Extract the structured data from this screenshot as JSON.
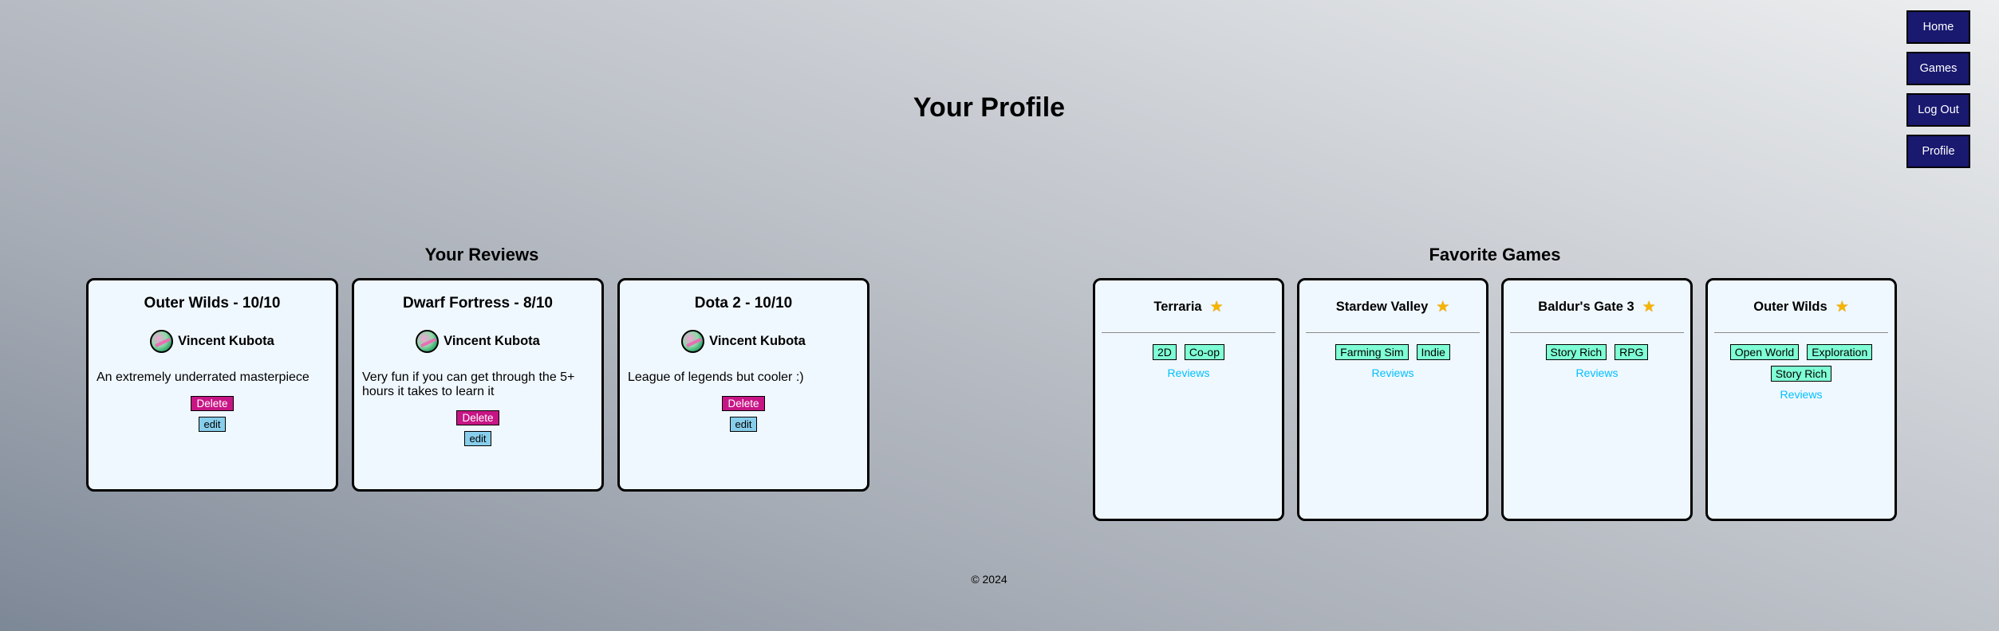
{
  "nav": {
    "items": [
      "Home",
      "Games",
      "Log Out",
      "Profile"
    ]
  },
  "page": {
    "title": "Your Profile"
  },
  "reviews_section": {
    "title": "Your Reviews",
    "cards": [
      {
        "title": "Outer Wilds - 10/10",
        "author": "Vincent Kubota",
        "text": "An extremely underrated masterpiece",
        "delete_label": "Delete",
        "edit_label": "edit"
      },
      {
        "title": "Dwarf Fortress - 8/10",
        "author": "Vincent Kubota",
        "text": "Very fun if you can get through the 5+ hours it takes to learn it",
        "delete_label": "Delete",
        "edit_label": "edit"
      },
      {
        "title": "Dota 2 - 10/10",
        "author": "Vincent Kubota",
        "text": "League of legends but cooler :)",
        "delete_label": "Delete",
        "edit_label": "edit"
      }
    ]
  },
  "favorites_section": {
    "title": "Favorite Games",
    "cards": [
      {
        "name": "Terraria",
        "icon": "star-icon",
        "tags": [
          "2D",
          "Co-op"
        ],
        "link": "Reviews"
      },
      {
        "name": "Stardew Valley",
        "icon": "star-icon",
        "tags": [
          "Farming Sim",
          "Indie"
        ],
        "link": "Reviews"
      },
      {
        "name": "Baldur's Gate 3",
        "icon": "star-icon",
        "tags": [
          "Story Rich",
          "RPG"
        ],
        "link": "Reviews"
      },
      {
        "name": "Outer Wilds",
        "icon": "star-icon",
        "tags": [
          "Open World",
          "Exploration",
          "Story Rich"
        ],
        "link": "Reviews"
      }
    ]
  },
  "footer": {
    "text": "© 2024"
  },
  "colors": {
    "nav_bg": "#191970",
    "card_bg": "#f0f8ff",
    "delete_bg": "#c71585",
    "edit_bg": "#87ceeb",
    "tag_bg": "#7fffd4",
    "link": "#00bfff",
    "star": "#f5b400"
  }
}
